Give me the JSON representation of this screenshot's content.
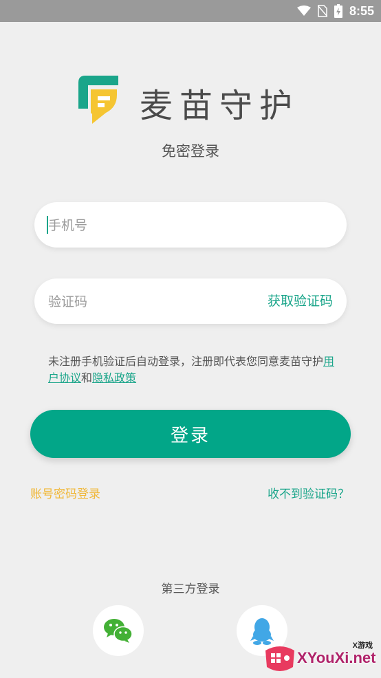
{
  "status_bar": {
    "time": "8:55",
    "icons": [
      "wifi-icon",
      "no-sim-icon",
      "battery-icon"
    ]
  },
  "brand": {
    "name": "麦苗守护",
    "logo_colors": [
      "#1aa58a",
      "#f5c532"
    ]
  },
  "subtitle": "免密登录",
  "phone_field": {
    "placeholder": "手机号",
    "value": ""
  },
  "code_field": {
    "placeholder": "验证码",
    "value": "",
    "get_code_label": "获取验证码"
  },
  "agreement": {
    "text": "未注册手机验证后自动登录，注册即代表您同意麦苗守护",
    "user_agreement": "用户协议",
    "and": "和",
    "privacy_policy": "隐私政策"
  },
  "login_button": "登录",
  "links": {
    "password_login": "账号密码登录",
    "no_code": "收不到验证码？"
  },
  "third_party": {
    "title": "第三方登录",
    "options": [
      "wechat-icon",
      "qq-icon"
    ]
  },
  "watermark": {
    "text": "XYouXi.net",
    "badge": "X游戏"
  },
  "colors": {
    "accent": "#02a688",
    "link": "#1aa58a",
    "secondary_link": "#f0b83a",
    "background": "#efefef"
  }
}
